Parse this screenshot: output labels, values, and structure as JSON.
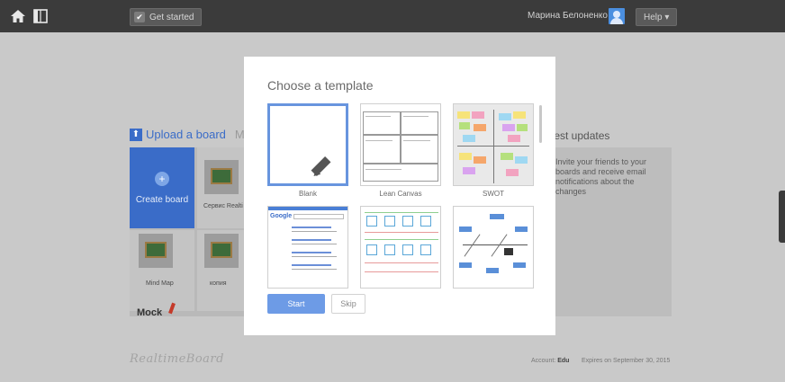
{
  "topbar": {
    "get_started_label": "Get started",
    "user_name": "Марина Белоненко ▾",
    "help_label": "Help ▾"
  },
  "background": {
    "upload_board_label": "Upload a board",
    "my_boards_label": "My b",
    "latest_updates_label": "test updates",
    "create_board_label": "Create board",
    "tiles": [
      "Сервис Realti",
      "Mind Map",
      "копия"
    ],
    "mock_label": "Mock",
    "updates_text": "Invite your friends to your boards and receive email notifications about the changes"
  },
  "footer": {
    "logo_text": "RealtimeBoard",
    "account_label": "Account:",
    "account_value": "Edu",
    "expires_text": "Expires on September 30, 2015"
  },
  "modal": {
    "title": "Choose a template",
    "templates": [
      {
        "label": "Blank"
      },
      {
        "label": "Lean Canvas"
      },
      {
        "label": "SWOT"
      }
    ],
    "google_label": "Google",
    "start_label": "Start",
    "skip_label": "Skip"
  },
  "colors": {
    "accent": "#3a6cc8",
    "selected_border": "#6895de",
    "start_button": "#6d9be6"
  }
}
